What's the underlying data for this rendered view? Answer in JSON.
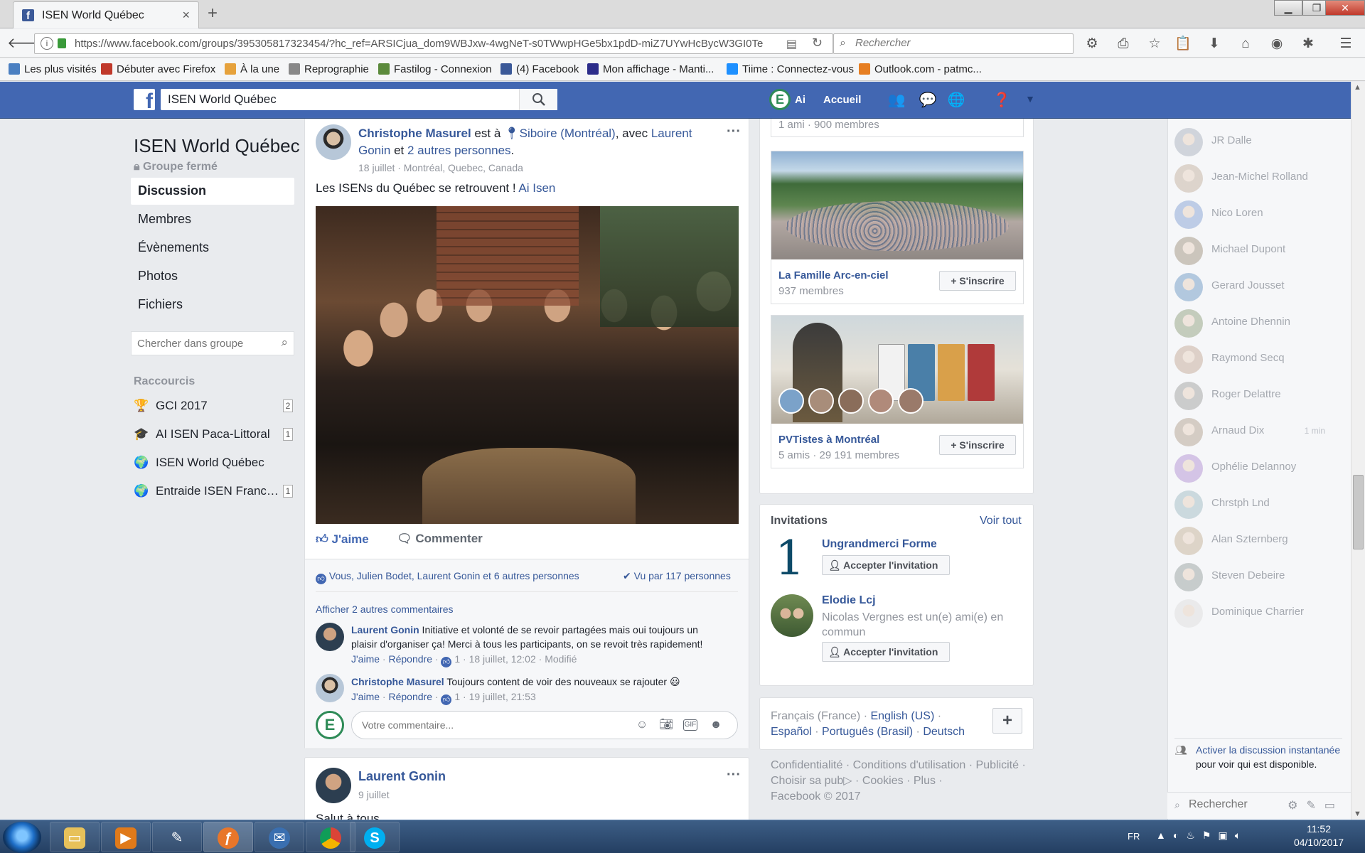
{
  "browser": {
    "tab_title": "ISEN World Québec",
    "tab_close": "×",
    "new_tab": "+",
    "url": "https://www.facebook.com/groups/395305817323454/?hc_ref=ARSICjua_dom9WBJxw-4wgNeT-s0TWwpHGe5bx1pdD-miZ7UYwHcBycW3GI0Te",
    "search_placeholder": "Rechercher",
    "bookmarks": [
      {
        "label": "Les plus visités",
        "color": "#4a7fc1"
      },
      {
        "label": "Débuter avec Firefox",
        "color": "#c0392b"
      },
      {
        "label": "À la une",
        "color": "#e6a23c"
      },
      {
        "label": "Reprographie",
        "color": "#888888"
      },
      {
        "label": "Fastilog - Connexion",
        "color": "#5b8a3c"
      },
      {
        "label": "(4) Facebook",
        "color": "#3b5998"
      },
      {
        "label": "Mon affichage - Manti...",
        "color": "#2c2c8a"
      },
      {
        "label": "Tiime : Connectez-vous",
        "color": "#1e90ff"
      },
      {
        "label": "Outlook.com - patmc...",
        "color": "#e67e22"
      }
    ]
  },
  "fb_header": {
    "search_value": "ISEN World Québec",
    "user_initial": "E",
    "user_name": "Ai",
    "home_label": "Accueil"
  },
  "group": {
    "name": "ISEN World Québec",
    "status": "Groupe fermé",
    "nav": [
      "Discussion",
      "Membres",
      "Évènements",
      "Photos",
      "Fichiers"
    ],
    "search_placeholder": "Chercher dans groupe",
    "shortcuts_title": "Raccourcis",
    "shortcuts": [
      {
        "icon": "🏆",
        "label": "GCI 2017",
        "count": "2"
      },
      {
        "icon": "🎓",
        "label": "AI ISEN Paca-Littoral",
        "count": "1"
      },
      {
        "icon": "🌍",
        "label": "ISEN World Québec",
        "count": ""
      },
      {
        "icon": "🌍",
        "label": "Entraide ISEN Franc…",
        "count": "1"
      }
    ]
  },
  "post1": {
    "author": "Christophe Masurel",
    "at_text": " est à ",
    "place": "Siboire (Montréal)",
    "with_text": ", avec ",
    "tagged": "Laurent Gonin",
    "and_text": " et ",
    "others": "2 autres personnes",
    "period": ".",
    "meta": "18 juillet · Montréal, Quebec, Canada",
    "text": "Les ISENs du Québec se retrouvent ! ",
    "mention": "Ai Isen",
    "more": "···",
    "like_label": "J'aime",
    "comment_label": "Commenter",
    "likes_summary": "Vous, Julien Bodet, Laurent Gonin et 6 autres personnes",
    "seen": "Vu par 117 personnes",
    "more_comments": "Afficher 2 autres commentaires",
    "comments": [
      {
        "author": "Laurent Gonin",
        "text": " Initiative et volonté de se revoir partagées mais oui toujours un plaisir d'organiser ça! Merci à tous les participants, on se revoit très rapidement!",
        "like": "J'aime",
        "reply": "Répondre",
        "count": "1",
        "date": "18 juillet, 12:02",
        "edited": "Modifié"
      },
      {
        "author": "Christophe Masurel",
        "text": " Toujours content de voir des nouveaux se rajouter 😃",
        "like": "J'aime",
        "reply": "Répondre",
        "count": "1",
        "date": "19 juillet, 21:53",
        "edited": ""
      }
    ],
    "comment_placeholder": "Votre commentaire...",
    "my_initial": "E"
  },
  "post2": {
    "author": "Laurent Gonin",
    "date": "9 juillet",
    "text": "Salut à tous",
    "more": "···"
  },
  "suggestions": {
    "top_remnant": "1 ami · 900 membres",
    "join_label": "S'inscrire",
    "items": [
      {
        "name": "La Famille Arc-en-ciel",
        "members": "937 membres"
      },
      {
        "name": "PVTistes à Montréal",
        "members": "5 amis · 29 191 membres"
      }
    ]
  },
  "invitations": {
    "title": "Invitations",
    "see_all": "Voir tout",
    "accept_label": "Accepter l'invitation",
    "items": [
      {
        "name": "Ungrandmerci Forme",
        "pic_glyph": "1",
        "mutual": ""
      },
      {
        "name": "Elodie Lcj",
        "mutual": "Nicolas Vergnes est un(e) ami(e) en commun"
      }
    ]
  },
  "languages": {
    "current": "Français (France)",
    "others": [
      "English (US)",
      "Español",
      "Português (Brasil)",
      "Deutsch"
    ],
    "plus": "+"
  },
  "footer": {
    "links": [
      "Confidentialité",
      "Conditions d'utilisation",
      "Publicité",
      "Choisir sa pub",
      "Cookies",
      "Plus"
    ],
    "copyright": "Facebook © 2017"
  },
  "chat": {
    "friends": [
      {
        "name": "JR Dalle",
        "ago": "",
        "color": "#b0b7c3"
      },
      {
        "name": "Jean-Michel Rolland",
        "ago": "",
        "color": "#c8b8a8"
      },
      {
        "name": "Nico Loren",
        "ago": "",
        "color": "#8fa9d6"
      },
      {
        "name": "Michael Dupont",
        "ago": "",
        "color": "#a89c8a"
      },
      {
        "name": "Gerard Jousset",
        "ago": "",
        "color": "#7ba2c9"
      },
      {
        "name": "Antoine Dhennin",
        "ago": "",
        "color": "#9aa88a"
      },
      {
        "name": "Raymond Secq",
        "ago": "",
        "color": "#c9b0a0"
      },
      {
        "name": "Roger Delattre",
        "ago": "",
        "color": "#a8a8a8"
      },
      {
        "name": "Arnaud Dix",
        "ago": "1 min",
        "color": "#b8a898"
      },
      {
        "name": "Ophélie Delannoy",
        "ago": "",
        "color": "#b89ad6"
      },
      {
        "name": "Chrstph Lnd",
        "ago": "",
        "color": "#a8c0c8"
      },
      {
        "name": "Alan Szternberg",
        "ago": "",
        "color": "#c9b8a0"
      },
      {
        "name": "Steven Debeire",
        "ago": "",
        "color": "#a0a8a8"
      },
      {
        "name": "Dominique Charrier",
        "ago": "",
        "color": "#e0e0e0"
      }
    ],
    "activate_link": "Activer la discussion instantanée",
    "activate_rest": " pour voir qui est disponible.",
    "search_placeholder": "Rechercher"
  },
  "taskbar": {
    "lang": "FR",
    "time": "11:52",
    "date": "04/10/2017"
  }
}
